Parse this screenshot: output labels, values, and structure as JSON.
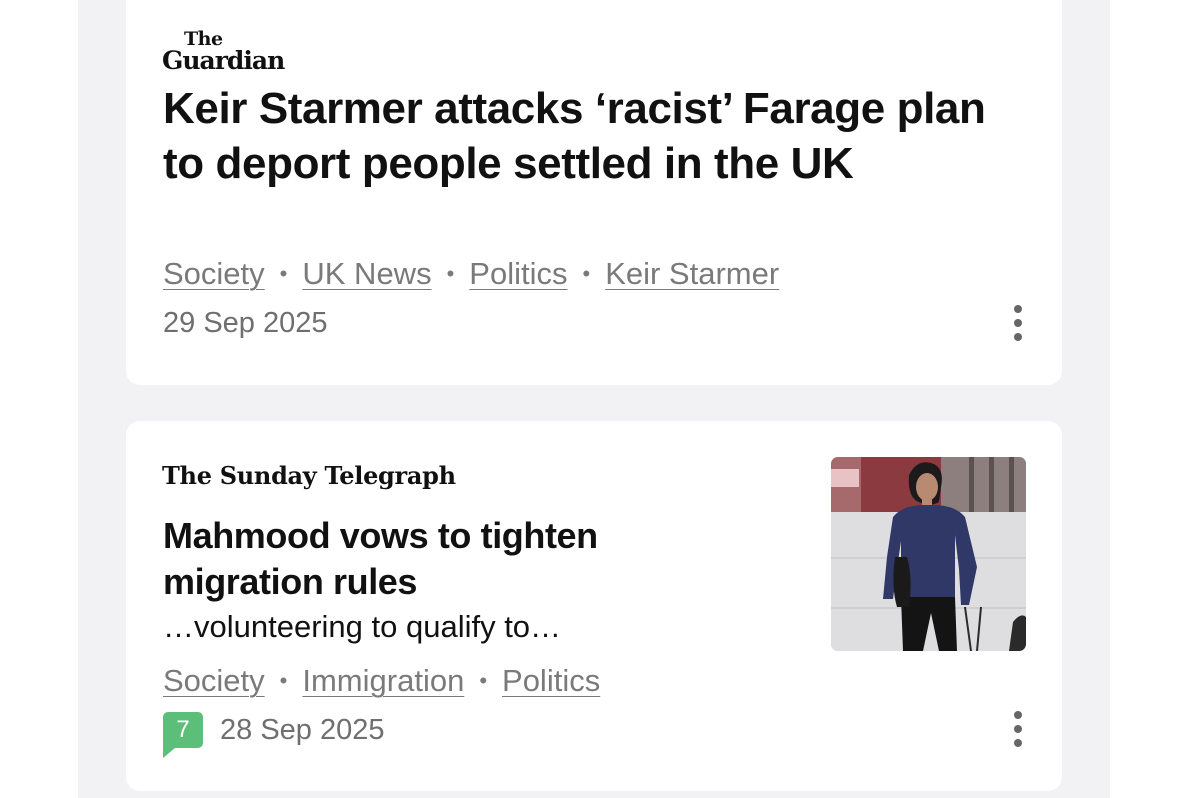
{
  "articles": [
    {
      "source": {
        "line1": "The",
        "line2": "Guardian"
      },
      "headline": "Keir Starmer attacks ‘racist’ Farage plan to deport people settled in the UK",
      "tags": [
        "Society",
        "UK News",
        "Politics",
        "Keir Starmer"
      ],
      "date": "29 Sep 2025",
      "more_icon": "more-vertical-icon"
    },
    {
      "source": {
        "name": "The Sunday Telegraph"
      },
      "headline": "Mahmood vows to tighten migration rules",
      "snippet": "…volunteering to qualify to…",
      "tags": [
        "Society",
        "Immigration",
        "Politics"
      ],
      "comment_count": "7",
      "comment_color": "#5cbf79",
      "date": "28 Sep 2025",
      "more_icon": "more-vertical-icon",
      "thumbnail_icon": "article-photo"
    }
  ]
}
